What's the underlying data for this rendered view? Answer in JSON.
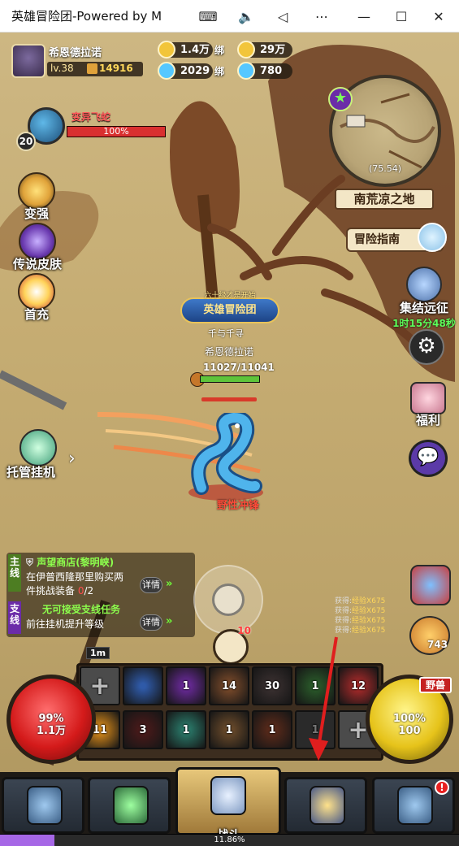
{
  "window": {
    "title": "英雄冒险团-Powered by M",
    "buttons": [
      "keyboard-icon",
      "volume-icon",
      "back-icon",
      "more-icon",
      "minimize-icon",
      "maximize-icon",
      "close-icon"
    ]
  },
  "player": {
    "name": "希恩德拉诺",
    "level": "lv.38",
    "power": "14916"
  },
  "resources": {
    "gold": "1.4万",
    "bound_gold_tag": "绑",
    "bound_gold": "29万",
    "diamond": "2029",
    "bound_diamond_tag": "绑",
    "bound_diamond": "780"
  },
  "enemy": {
    "name": "变异飞蛇",
    "level": "20",
    "hp_text": "100%",
    "hp_fraction": 1.0
  },
  "left_menu": [
    {
      "label": "变强",
      "icon": "upgrade-icon"
    },
    {
      "label": "传说皮肤",
      "icon": "skin-icon"
    },
    {
      "label": "首充",
      "icon": "first-charge-icon"
    }
  ],
  "map": {
    "coord": "(75.54)",
    "name": "南荒凉之地",
    "guide": "冒险指南"
  },
  "rally": {
    "label": "集结远征",
    "timer": "1时15分48秒"
  },
  "welfare_label": "福利",
  "hero": {
    "guild_small": "六十级才是开始",
    "guild_big": "英雄冒险团",
    "title": "千与千寻",
    "name": "希恩德拉诺",
    "hp_text": "11027/11041",
    "hp_fraction": 0.9987,
    "skill": "野性冲锋"
  },
  "auto_label": "托管挂机",
  "quests": {
    "main_tag": "主线",
    "main_title": "声望商店(黎明峡)",
    "main_body_1": "在伊普西隆那里购买两",
    "main_body_2": "件挑战装备",
    "main_progress": "0",
    "main_total": "/2",
    "detail": "详情",
    "side_tag": "支线",
    "side_title": "无可接受支线任务",
    "side_body": "前往挂机提升等级"
  },
  "exp_log": [
    {
      "label": "获得:",
      "value": "经验X675"
    },
    {
      "label": "获得:",
      "value": "经验X675"
    },
    {
      "label": "获得:",
      "value": "经验X675"
    },
    {
      "label": "获得:",
      "value": "经验X675"
    }
  ],
  "pizza_count": "743",
  "level_ball_count": "10",
  "slot_tag": "1m",
  "skill_slots_row1": [
    "",
    "",
    "1",
    "14",
    "30",
    "1",
    "12"
  ],
  "skill_slots_row2": [
    "11",
    "3",
    "1",
    "1",
    "1",
    "1",
    ""
  ],
  "red_orb": {
    "line1": "99%",
    "line2": "1.1万"
  },
  "yellow_orb": {
    "line1": "100%",
    "line2": "100"
  },
  "wild_tag": "野兽",
  "nav": {
    "battle": "战斗",
    "badge": "!"
  },
  "xp": {
    "text": "11.86%",
    "fraction": 0.1186
  },
  "colors": {
    "hp_red": "#d93030",
    "hp_green": "#5ec43a",
    "quest_green": "#8dff4d",
    "timer_green": "#5dff5a",
    "xp_purple": "#a667e6"
  }
}
